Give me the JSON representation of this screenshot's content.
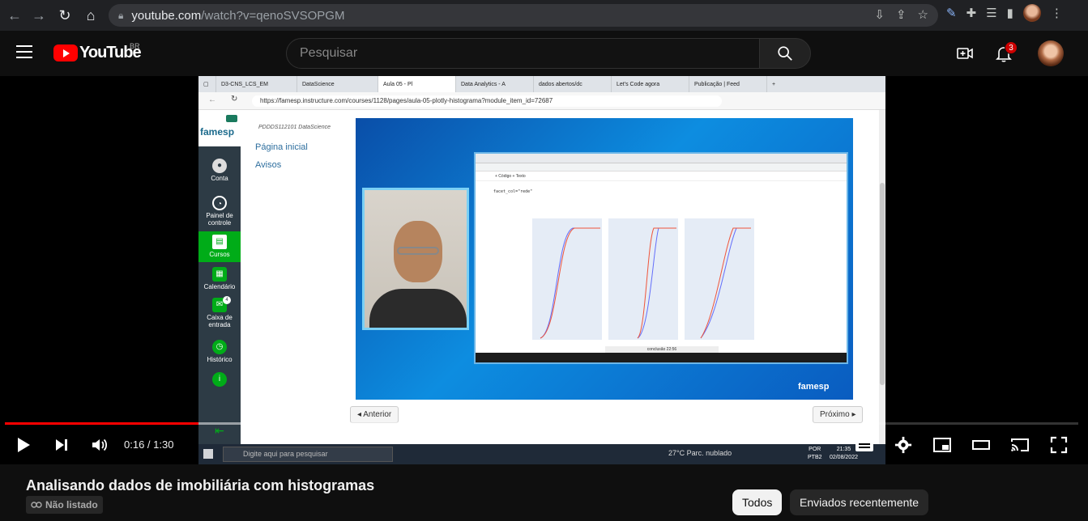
{
  "browser": {
    "url_host": "youtube.com",
    "url_path": "/watch?v=qenoSVSOPGM"
  },
  "header": {
    "logo_text": "YouTube",
    "country": "BR",
    "search_placeholder": "Pesquisar",
    "notification_count": "3"
  },
  "video": {
    "edge_tabs": [
      "D3-CNS_LCS_EM",
      "DataScience",
      "Aula 05 - Pl",
      "Data Analytics - A",
      "dados abertos/dc",
      "Let's Code agora",
      "Publicação | Feed"
    ],
    "edge_url": "https://famesp.instructure.com/courses/1128/pages/aula-05-plotly-histograma?module_item_id=72687",
    "canvas_logo": "famesp",
    "sidebar": [
      "Conta",
      "Painel de controle",
      "Cursos",
      "Calendário",
      "Caixa de entrada",
      "Histórico"
    ],
    "inbox_badge": "4",
    "course_code": "PDDDS112101 DataScience",
    "course_nav": [
      "Página inicial",
      "Avisos"
    ],
    "colab_toolbar": "+ Código   + Texto",
    "colab_code": "facet_col=\"rede\"",
    "colab_status": "conclusão 22:56",
    "slide_brand": "famesp",
    "pager_prev": "◂ Anterior",
    "pager_next": "Próximo ▸",
    "win_search": "Digite aqui para pesquisar",
    "win_weather": "27°C  Parc. nublado",
    "win_lang_1": "POR",
    "win_lang_2": "PTB2",
    "win_time": "21:35",
    "win_date": "02/08/2022"
  },
  "player": {
    "time_display": "0:16 / 1:30",
    "played_fraction": 0.18,
    "loaded_fraction": 0.54
  },
  "below": {
    "title": "Analisando dados de imobiliária com histogramas",
    "visibility": "Não listado",
    "chips": [
      "Todos",
      "Enviados recentemente"
    ]
  }
}
